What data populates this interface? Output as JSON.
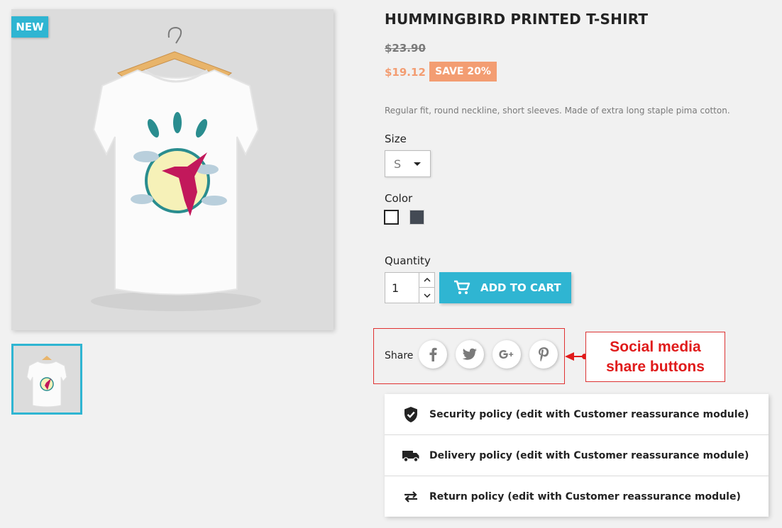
{
  "product": {
    "badge_new": "NEW",
    "title": "HUMMINGBIRD PRINTED T-SHIRT",
    "old_price": "$23.90",
    "price": "$19.12",
    "discount": "SAVE 20%",
    "description": "Regular fit, round neckline, short sleeves. Made of extra long staple pima cotton."
  },
  "options": {
    "size_label": "Size",
    "size_value": "S",
    "color_label": "Color",
    "colors": [
      "#ffffff",
      "#434a54"
    ],
    "quantity_label": "Quantity",
    "quantity_value": "1"
  },
  "cart": {
    "add_label": "ADD TO CART"
  },
  "share": {
    "label": "Share",
    "networks": [
      "facebook",
      "twitter",
      "google-plus",
      "pinterest"
    ]
  },
  "annotation": {
    "line1": "Social media",
    "line2": "share buttons"
  },
  "reassurance": [
    {
      "icon": "shield-check-icon",
      "text": "Security policy (edit with Customer reassurance module)"
    },
    {
      "icon": "truck-icon",
      "text": "Delivery policy (edit with Customer reassurance module)"
    },
    {
      "icon": "swap-arrows-icon",
      "text": "Return policy (edit with Customer reassurance module)"
    }
  ],
  "colors": {
    "accent": "#2fb5d2",
    "discount": "#f39d72",
    "annotation": "#e01b1b"
  }
}
